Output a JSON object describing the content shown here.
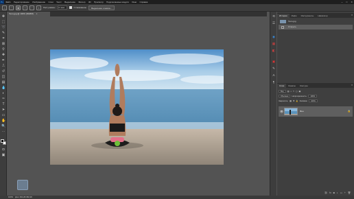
{
  "app": {
    "logo": "Ps"
  },
  "menu": [
    "Файл",
    "Редактирование",
    "Изображение",
    "Слои",
    "Текст",
    "Выделение",
    "Фильтр",
    "3D",
    "Просмотр",
    "Подключаемые модули",
    "Окно",
    "Справка"
  ],
  "options": {
    "tolerance_label": "Растушёвка:",
    "tolerance_value": "0 пикс.",
    "antialias_label": "Сглаживание",
    "select_mask_button": "Выделение и маска..."
  },
  "document": {
    "tab_title": "Тело.jpg @ 100% (RGB/8)",
    "tab_close": "×"
  },
  "status": {
    "zoom": "100%",
    "doc_info": "Док: 462,2K/462,2K"
  },
  "history_panel": {
    "tabs": [
      "История",
      "Инфо",
      "Инструменты",
      "Навигатор"
    ],
    "snapshot_label": "Тело.jpg",
    "steps": [
      {
        "label": "Открыть"
      }
    ]
  },
  "layers_panel": {
    "tabs": [
      "Слои",
      "Каналы",
      "Контуры"
    ],
    "filter_label": "Вид",
    "blend_mode": "Обычные",
    "opacity_label": "Непрозрачность:",
    "opacity_value": "100%",
    "lock_label": "Закрепить:",
    "fill_label": "Заливка:",
    "fill_value": "100%",
    "layers": [
      {
        "name": "Фон"
      }
    ]
  },
  "icons": {
    "lock": "lock-icon",
    "eye": "eye-icon",
    "close": "close-icon"
  }
}
